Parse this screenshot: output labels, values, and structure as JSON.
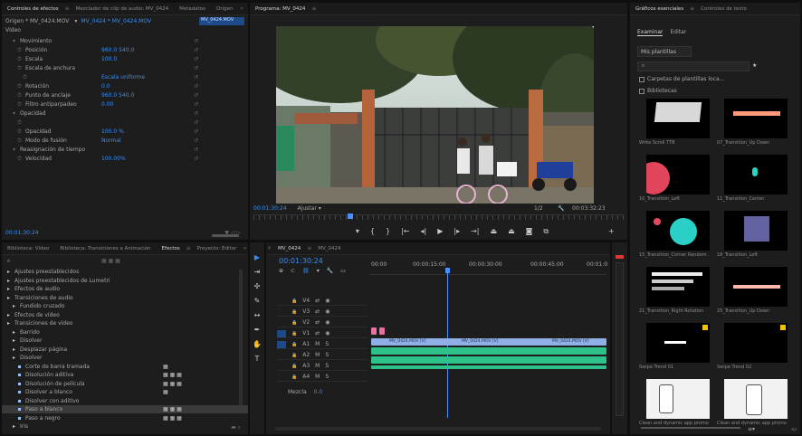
{
  "effect_controls": {
    "tabs": [
      "Controles de efectos",
      "Mezclador de clip de audio: MV_0424",
      "Metadatos",
      "Origen"
    ],
    "source_label": "Origen * MV_0424.MOV",
    "sequence_label": "MV_0424 * MV_0424.MOV",
    "clip_name": "MV_0424.MOV",
    "video_label": "Vídeo",
    "timecode": "00:01:30:24",
    "rows": [
      {
        "indent": 1,
        "label": "Movimiento",
        "value": ""
      },
      {
        "indent": 2,
        "label": "Posición",
        "value": "960.0    540.0"
      },
      {
        "indent": 2,
        "label": "Escala",
        "value": "100.0"
      },
      {
        "indent": 2,
        "label": "Escala de anchura",
        "value": ""
      },
      {
        "indent": 3,
        "label": "",
        "value": "Escala uniforme"
      },
      {
        "indent": 2,
        "label": "Rotación",
        "value": "0.0"
      },
      {
        "indent": 2,
        "label": "Punto de anclaje",
        "value": "960.0    540.0"
      },
      {
        "indent": 2,
        "label": "Filtro antiparpadeo",
        "value": "0.00"
      },
      {
        "indent": 1,
        "label": "Opacidad",
        "value": ""
      },
      {
        "indent": 2,
        "label": "",
        "value": ""
      },
      {
        "indent": 2,
        "label": "Opacidad",
        "value": "100.0 %"
      },
      {
        "indent": 2,
        "label": "Modo de fusión",
        "value": "Normal"
      },
      {
        "indent": 1,
        "label": "Reasignación de tiempo",
        "value": ""
      },
      {
        "indent": 2,
        "label": "Velocidad",
        "value": "100.00%"
      }
    ]
  },
  "program": {
    "title": "Programa: MV_0424",
    "timecode": "00:01:30:24",
    "fit": "Ajustar",
    "quality": "1/2",
    "duration": "00:03:32:23"
  },
  "project": {
    "tabs": [
      "Biblioteca: Vídeo",
      "Biblioteca: Transiciones a Animación",
      "Efectos",
      "Proyecto: Editor"
    ],
    "items": [
      {
        "indent": 0,
        "label": "Ajustes preestablecidos",
        "icons": ""
      },
      {
        "indent": 0,
        "label": "Ajustes preestablecidos de Lumetri",
        "icons": ""
      },
      {
        "indent": 0,
        "label": "Efectos de audio",
        "icons": ""
      },
      {
        "indent": 0,
        "label": "Transiciones de audio",
        "icons": ""
      },
      {
        "indent": 1,
        "label": "Fundido cruzado",
        "icons": ""
      },
      {
        "indent": 0,
        "label": "Efectos de vídeo",
        "icons": ""
      },
      {
        "indent": 0,
        "label": "Transiciones de vídeo",
        "icons": ""
      },
      {
        "indent": 1,
        "label": "Barrido",
        "icons": ""
      },
      {
        "indent": 1,
        "label": "Disolver",
        "icons": ""
      },
      {
        "indent": 1,
        "label": "Desplazar página",
        "icons": ""
      },
      {
        "indent": 1,
        "label": "Disolver",
        "icons": ""
      },
      {
        "indent": 2,
        "label": "Corte de barra tramada",
        "icons": "▦"
      },
      {
        "indent": 2,
        "label": "Disolución aditiva",
        "icons": "▦  ▦  ▦"
      },
      {
        "indent": 2,
        "label": "Disolución de película",
        "icons": "▦  ▦  ▦"
      },
      {
        "indent": 2,
        "label": "Disolver a blanco",
        "icons": "▦"
      },
      {
        "indent": 2,
        "label": "Disolver con aditivo",
        "icons": ""
      },
      {
        "indent": 2,
        "label": "Paso a blanco",
        "icons": "▦  ▦  ▦"
      },
      {
        "indent": 2,
        "label": "Paso a negro",
        "icons": "▦  ▦  ▦"
      },
      {
        "indent": 1,
        "label": "Iris",
        "icons": ""
      }
    ]
  },
  "timeline": {
    "tabs": [
      "MV_0424",
      "MV_0424"
    ],
    "timecode": "00:01:30:24",
    "ruler": [
      "00:00",
      "00:00:15:00",
      "00:00:30:00",
      "00:00:45:00",
      "00:01:0"
    ],
    "tracks": [
      {
        "name": "V4",
        "type": "v"
      },
      {
        "name": "V3",
        "type": "v"
      },
      {
        "name": "V2",
        "type": "v"
      },
      {
        "name": "V1",
        "type": "v"
      },
      {
        "name": "A1",
        "type": "a"
      },
      {
        "name": "A2",
        "type": "a"
      },
      {
        "name": "A3",
        "type": "a"
      },
      {
        "name": "A4",
        "type": "a"
      }
    ],
    "master_label": "Mezcla",
    "master_value": "0.0",
    "clip_labels": [
      "MV_0424.MOV [V]",
      "MV_0424.MOV [V]",
      "MV_0424.MOV [V]"
    ]
  },
  "graphics": {
    "tabs": [
      "Gráficos esenciales",
      "Controles de texto"
    ],
    "sub_tabs": [
      "Examinar",
      "Editar"
    ],
    "dropdown": "Mis plantillas",
    "search_placeholder": "",
    "check1": "Carpetas de plantillas loca...",
    "check2": "Bibliotecas",
    "items": [
      {
        "label": "Write Scroll TTB"
      },
      {
        "label": "07_Transition_Up Down"
      },
      {
        "label": "10_Transition_Left"
      },
      {
        "label": "11_Transition_Center"
      },
      {
        "label": "15_Transition_Corner Random"
      },
      {
        "label": "18_Transition_Left"
      },
      {
        "label": "21_Transition_Right Rotation"
      },
      {
        "label": "25_Transition_Up Down"
      },
      {
        "label": "Swipe Trend 01"
      },
      {
        "label": "Swipe Trend 02"
      },
      {
        "label": "Clean and dynamic app promo"
      },
      {
        "label": "Clean and dynamic app promo"
      }
    ]
  },
  "colors": {
    "accent": "#3c8df0",
    "video_clip": "#8fb0e6",
    "audio_clip": "#2ec28a",
    "playhead": "#4a90ff",
    "pink": "#e96fa3"
  }
}
